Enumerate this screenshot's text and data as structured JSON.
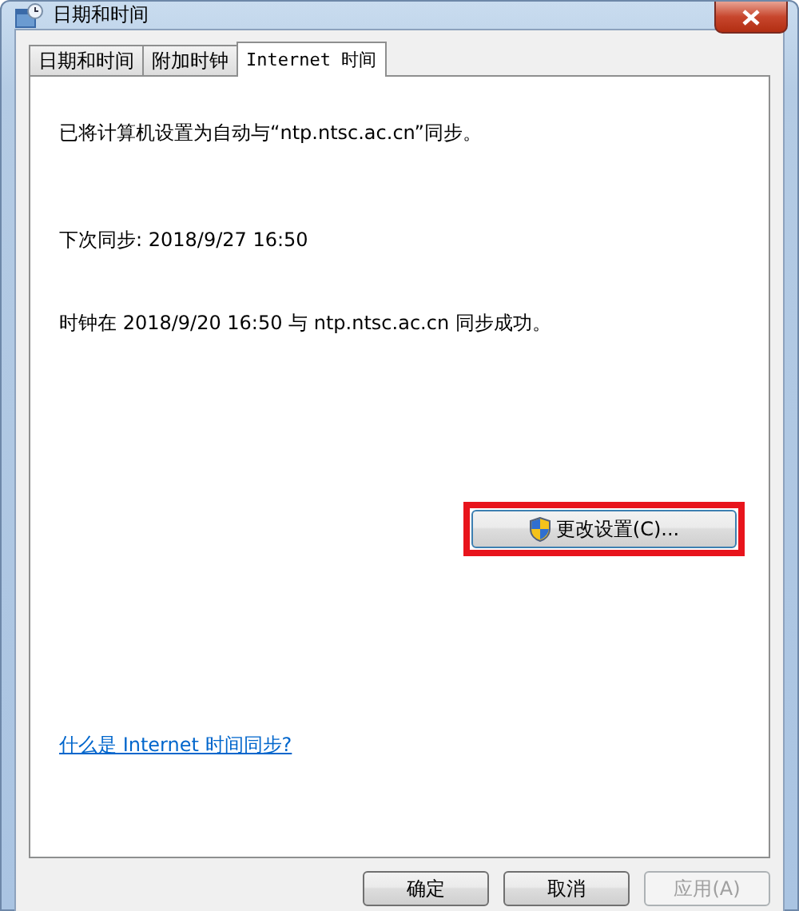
{
  "window": {
    "title": "日期和时间"
  },
  "tabs": [
    {
      "label": "日期和时间",
      "selected": false
    },
    {
      "label": "附加时钟",
      "selected": false
    },
    {
      "label": "Internet 时间",
      "selected": true
    }
  ],
  "panel": {
    "lines": [
      "已将计算机设置为自动与“ntp.ntsc.ac.cn”同步。",
      "下次同步: 2018/9/27 16:50",
      "时钟在 2018/9/20 16:50 与 ntp.ntsc.ac.cn 同步成功。"
    ],
    "change_button": {
      "label": "更改设置(C)...",
      "highlighted": true
    },
    "help_link": "什么是 Internet 时间同步?"
  },
  "buttons": [
    {
      "label": "确定",
      "disabled": false
    },
    {
      "label": "取消",
      "disabled": false
    },
    {
      "label": "应用(A)",
      "disabled": true
    }
  ]
}
